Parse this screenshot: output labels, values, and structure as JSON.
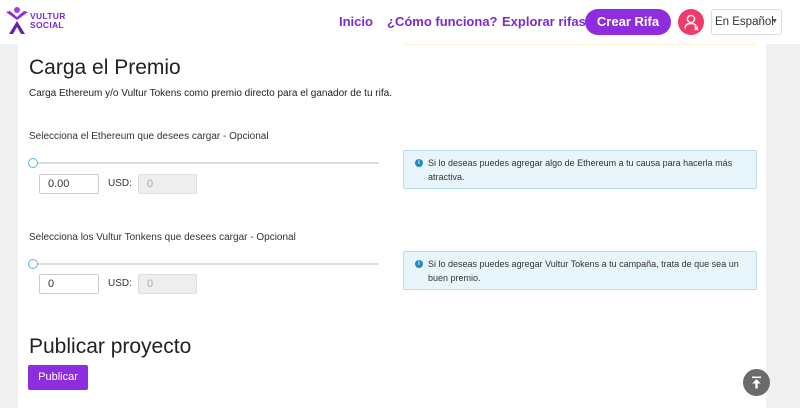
{
  "nav": {
    "logo_line1": "VULTUR",
    "logo_line2": "SOCIAL",
    "links": [
      "Inicio",
      "¿Cómo funciona?",
      "Explorar rifas"
    ],
    "create_label": "Crear Rifa",
    "language": "En Español"
  },
  "prize": {
    "title": "Carga el Premio",
    "subtitle": "Carga Ethereum y/o Vultur Tokens como premio directo para el ganador de tu rifa.",
    "ethereum": {
      "label": "Selecciona el Ethereum que desees cargar - Opcional",
      "value": "0.00",
      "usd_label": "USD:",
      "usd_value": "0",
      "info": "Si lo deseas puedes agregar algo de Ethereum a tu causa para hacerla más atractiva."
    },
    "tokens": {
      "label": "Selecciona los Vultur Tonkens que desees cargar - Opcional",
      "value": "0",
      "usd_label": "USD:",
      "usd_value": "0",
      "info": "Si lo deseas puedes agregar Vultur Tokens a tu campaña, trata de que sea un buen premio."
    }
  },
  "publish": {
    "title": "Publicar proyecto",
    "button": "Publicar"
  },
  "colors": {
    "brand": "#8e2ce0",
    "link": "#7b2bd0",
    "avatar": "#f03a6a",
    "info_bg": "#e8f5fb",
    "info_icon": "#1f8bc4"
  },
  "icons": {
    "logo": "vultur-social-logo-icon",
    "avatar": "user-avatar-icon",
    "info": "info-icon",
    "scroll_top": "arrow-up-to-top-icon"
  }
}
